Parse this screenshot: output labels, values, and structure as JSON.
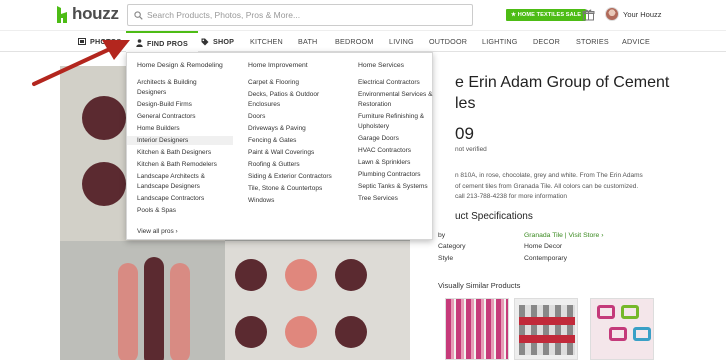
{
  "header": {
    "logo_text": "houzz",
    "search_placeholder": "Search Products, Photos, Pros & More...",
    "promo_badge": "HOME TEXTILES SALE",
    "user_label": "Your Houzz",
    "brand_color": "#4dbc15"
  },
  "nav": {
    "items": [
      {
        "label": "PHOTOS",
        "icon": "photos-icon"
      },
      {
        "label": "FIND PROS",
        "icon": "person-icon"
      },
      {
        "label": "SHOP",
        "icon": "tag-icon"
      },
      {
        "label": "KITCHEN"
      },
      {
        "label": "BATH"
      },
      {
        "label": "BEDROOM"
      },
      {
        "label": "LIVING"
      },
      {
        "label": "OUTDOOR"
      },
      {
        "label": "LIGHTING"
      },
      {
        "label": "DECOR"
      },
      {
        "label": "STORIES"
      },
      {
        "label": "ADVICE"
      }
    ],
    "active": "FIND PROS"
  },
  "dropdown": {
    "col1": {
      "heading": "Home Design & Remodeling",
      "items": [
        "Architects & Building",
        "Designers",
        "Design-Build Firms",
        "General Contractors",
        "Home Builders",
        "Interior Designers",
        "Kitchen & Bath Designers",
        "Kitchen & Bath Remodelers",
        "Landscape Architects &",
        "Landscape Designers",
        "Landscape Contractors",
        "Pools & Spas"
      ],
      "highlighted": "Interior Designers"
    },
    "col2": {
      "heading": "Home Improvement",
      "items": [
        "Carpet & Flooring",
        "Decks, Patios & Outdoor",
        "Enclosures",
        "Doors",
        "Driveways & Paving",
        "Fencing & Gates",
        "Paint & Wall Coverings",
        "Roofing & Gutters",
        "Siding & Exterior Contractors",
        "Tile, Stone & Countertops",
        "Windows"
      ]
    },
    "col3": {
      "heading": "Home Services",
      "items": [
        "Electrical Contractors",
        "Environmental Services &",
        "Restoration",
        "Furniture Refinishing &",
        "Upholstery",
        "Garage Doors",
        "HVAC Contractors",
        "Lawn & Sprinklers",
        "Plumbing Contractors",
        "Septic Tanks & Systems",
        "Tree Services"
      ]
    },
    "view_all": "View all pros ›"
  },
  "product": {
    "title_line1": "e Erin Adam Group of Cement",
    "title_line2": "les",
    "price": "09",
    "verified": "not verified",
    "description_line1": "n 810A, in rose, chocolate, grey and white. From The Erin Adams",
    "description_line2": "of cement tiles from Granada Tile. All colors can be customized.",
    "description_line3": "call 213-788-4238 for more information",
    "spec_heading": "uct Specifications",
    "specs": [
      {
        "key": "by",
        "value": "Granada Tile | Visit Store ›"
      },
      {
        "key": "Category",
        "value": "Home Decor"
      },
      {
        "key": "Style",
        "value": "Contemporary"
      }
    ],
    "similar_heading": "Visually Similar Products"
  }
}
